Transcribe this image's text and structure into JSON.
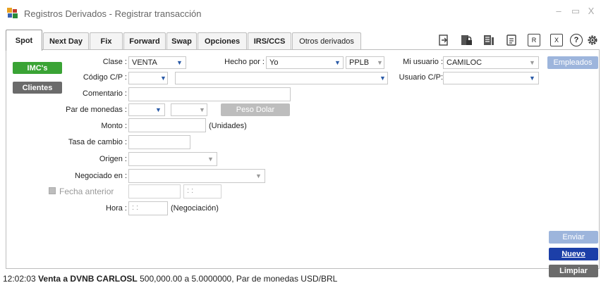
{
  "window": {
    "title": "Registros Derivados - Registrar transacción",
    "minimize": "–",
    "maximize": "▭",
    "close": "X"
  },
  "tabs": [
    {
      "label": "Spot",
      "active": true
    },
    {
      "label": "Next Day"
    },
    {
      "label": "Fix"
    },
    {
      "label": "Forward"
    },
    {
      "label": "Swap"
    },
    {
      "label": "Opciones"
    },
    {
      "label": "IRS/CCS"
    },
    {
      "label": "Otros derivados"
    }
  ],
  "toolbar_icons": [
    "document-arrow-icon",
    "lock-document-icon",
    "list-document-icon",
    "report-document-icon",
    "r-document-icon",
    "x-document-icon",
    "help-icon",
    "settings-icon"
  ],
  "toolbar": {
    "r": "R",
    "x": "X",
    "help": "?"
  },
  "buttons": {
    "imcs": "IMC's",
    "clientes": "Clientes",
    "empleados": "Empleados",
    "peso_dolar": "Peso Dolar",
    "enviar": "Enviar",
    "nuevo": "Nuevo",
    "limpiar": "Limpiar"
  },
  "form": {
    "clase": {
      "label": "Clase :",
      "value": "VENTA"
    },
    "hecho_por": {
      "label": "Hecho por :",
      "value": "Yo",
      "code": "PPLB"
    },
    "mi_usuario": {
      "label": "Mi usuario :",
      "value": "CAMILOC"
    },
    "codigo_cp": {
      "label": "Código C/P :",
      "value": "",
      "name": ""
    },
    "usuario_cp": {
      "label": "Usuario C/P:",
      "value": ""
    },
    "comentario": {
      "label": "Comentario :",
      "value": ""
    },
    "par_monedas": {
      "label": "Par de monedas :"
    },
    "monto": {
      "label": "Monto :",
      "unit": "(Unidades)"
    },
    "tasa_cambio": {
      "label": "Tasa de cambio :"
    },
    "origen": {
      "label": "Origen :"
    },
    "negociado_en": {
      "label": "Negociado en :"
    },
    "fecha_anterior": {
      "label": "Fecha anterior",
      "time_value": ": :"
    },
    "hora": {
      "label": "Hora :",
      "value": ": :",
      "note": "(Negociación)"
    }
  },
  "status_bar": {
    "time": "12:02:03",
    "bold_text": "Venta a DVNB CARLOSL",
    "rest_text": "500,000.00 a 5.0000000, Par de monedas USD/BRL"
  },
  "colors": {
    "green": "#3aa335",
    "dark_gray": "#6b6b6b",
    "blue": "#1c3fa8",
    "light_blue": "#9db5dc",
    "disabled_gray": "#bdbdbd"
  }
}
